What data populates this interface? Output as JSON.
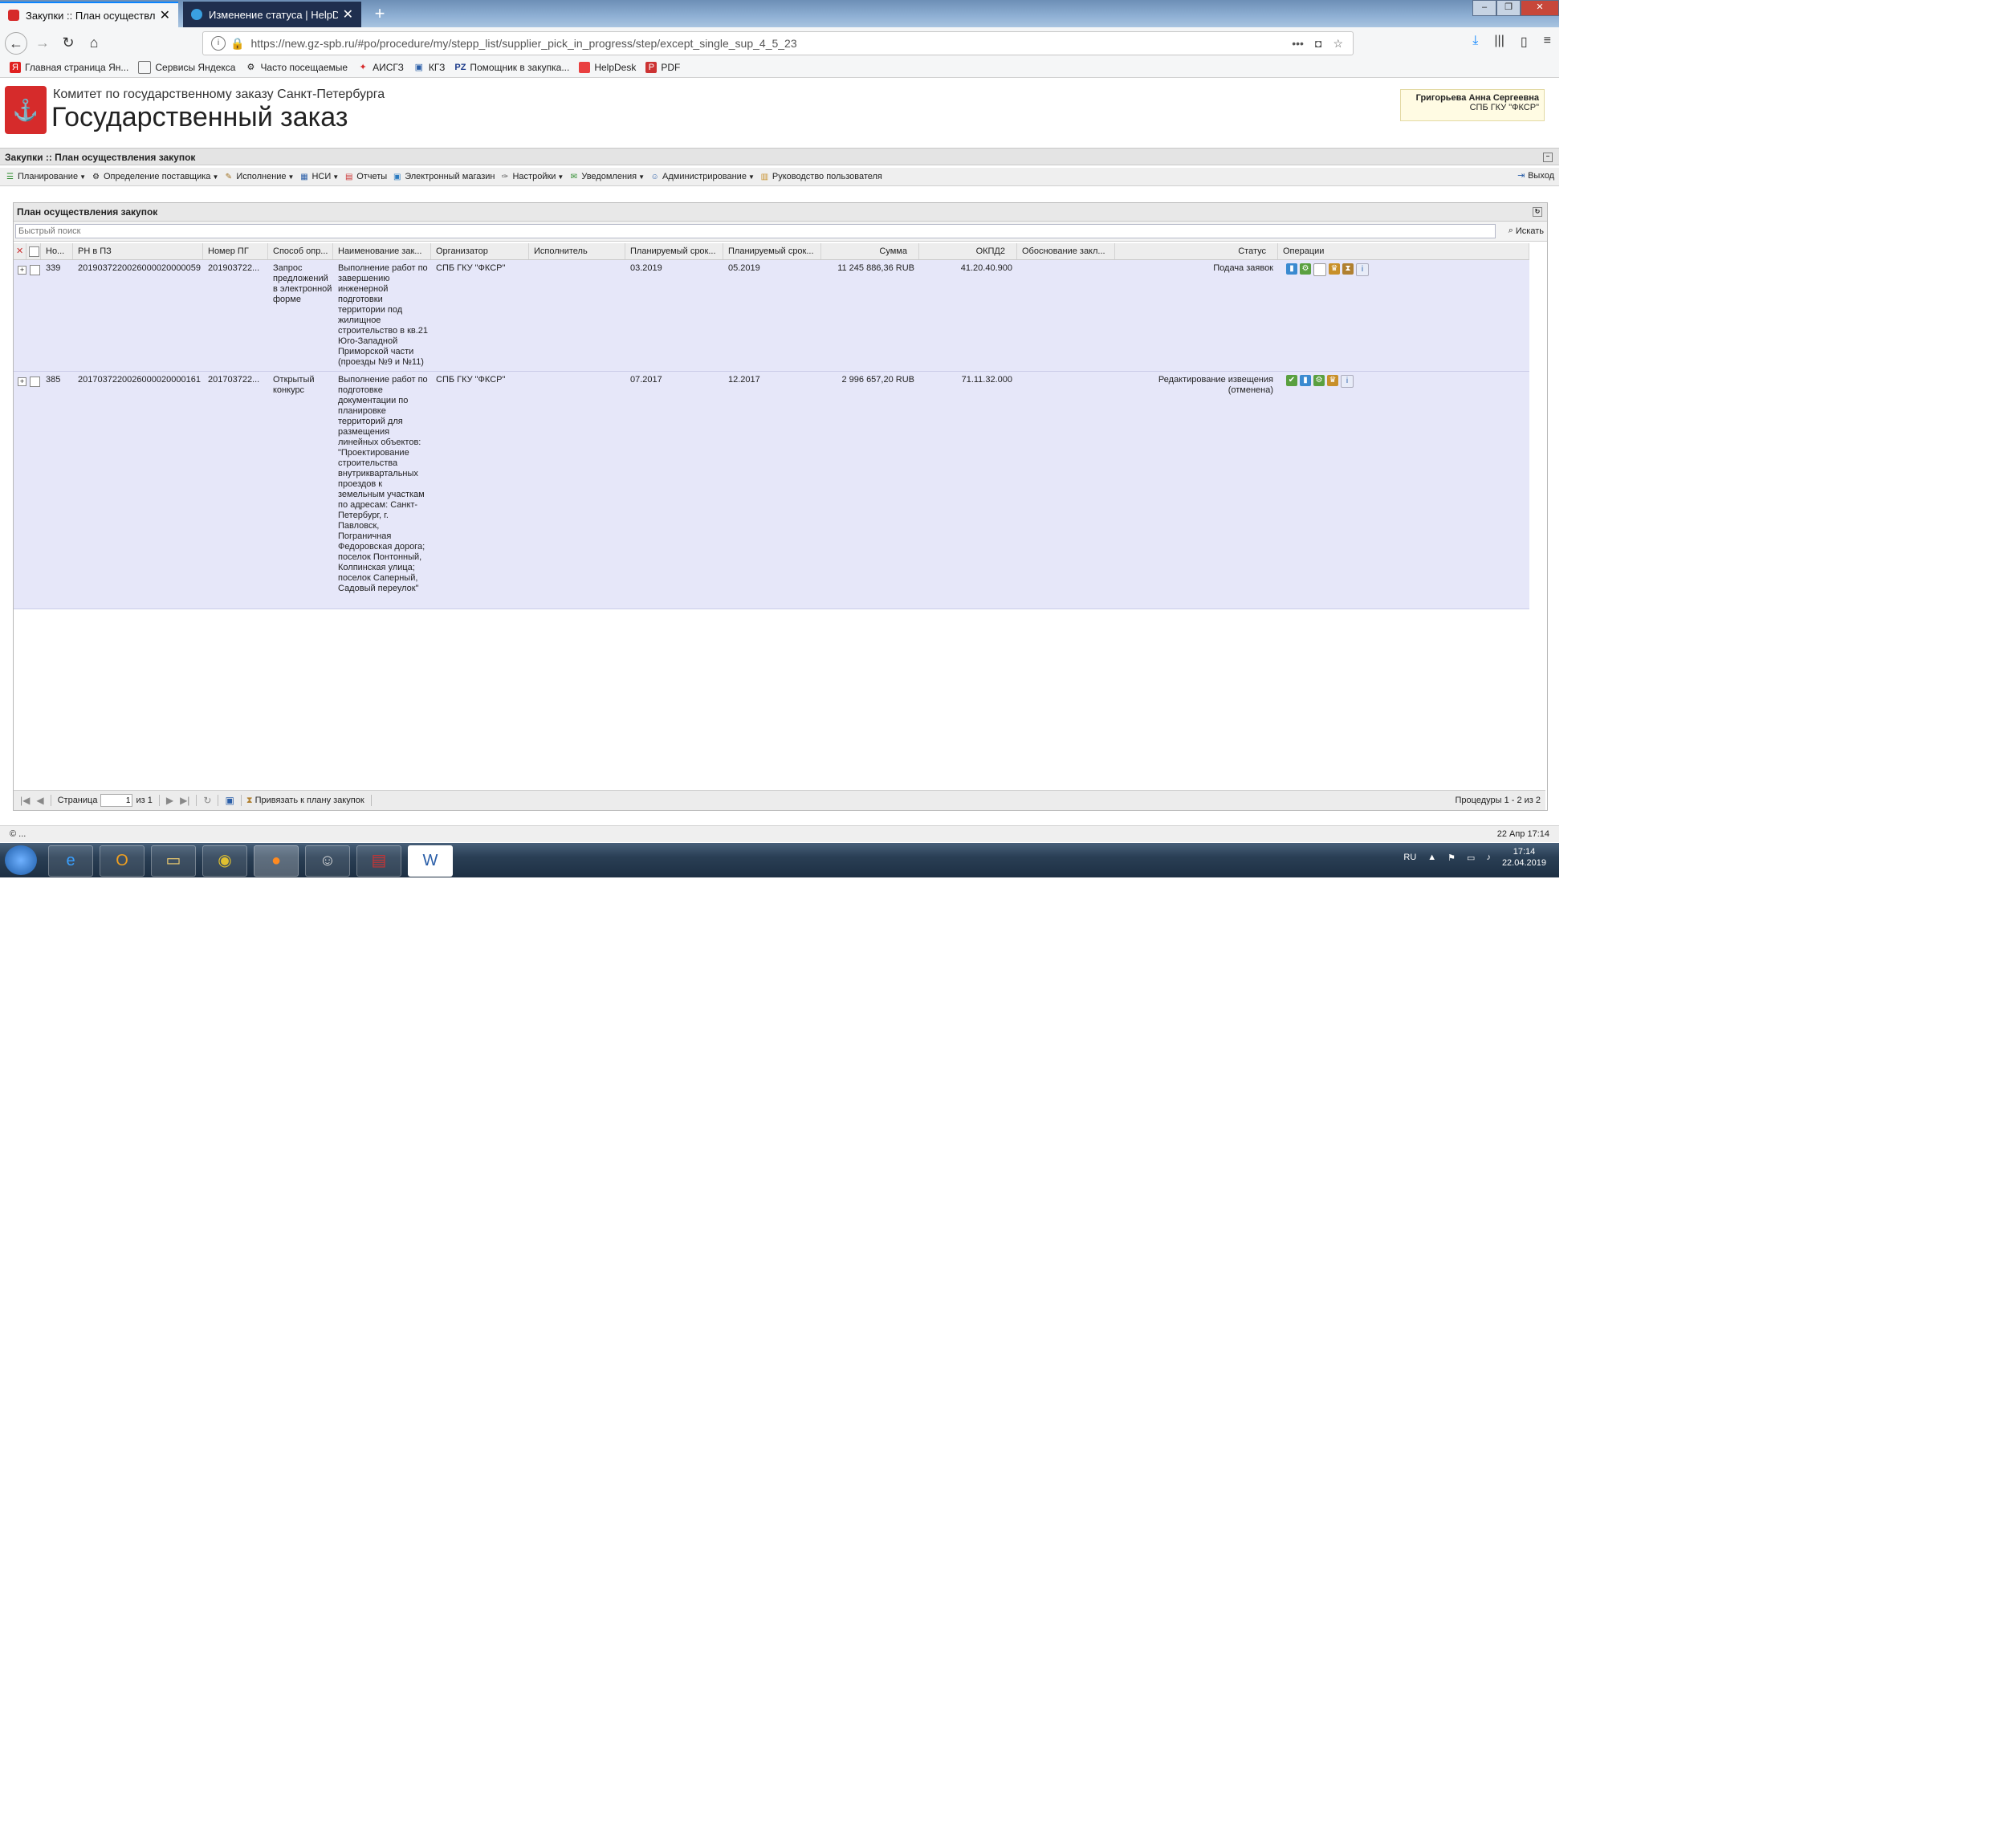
{
  "browser": {
    "tabs": [
      {
        "title": "Закупки :: План осуществлен",
        "active": true
      },
      {
        "title": "Изменение статуса | HelpDesk",
        "active": false
      }
    ],
    "url": "https://new.gz-spb.ru/#po/procedure/my/stepp_list/supplier_pick_in_progress/step/except_single_sup_4_5_23",
    "bookmarks": [
      "Главная страница Ян...",
      "Сервисы Яндекса",
      "Часто посещаемые",
      "АИСГЗ",
      "КГЗ",
      "Помощник в закупка...",
      "HelpDesk",
      "PDF"
    ]
  },
  "header": {
    "committee": "Комитет по государственному заказу Санкт-Петербурга",
    "title": "Государственный заказ",
    "user_name": "Григорьева Анна Сергеевна",
    "user_org": "СПБ ГКУ \"ФКСР\""
  },
  "section_title": "Закупки :: План осуществления закупок",
  "menu": {
    "items": [
      "Планирование",
      "Определение поставщика",
      "Исполнение",
      "НСИ",
      "Отчеты",
      "Электронный магазин",
      "Настройки",
      "Уведомления",
      "Администрирование",
      "Руководство пользователя"
    ],
    "exit": "Выход"
  },
  "panel": {
    "title": "План осуществления закупок",
    "search_placeholder": "Быстрый поиск",
    "search_button": "Искать"
  },
  "grid": {
    "columns": [
      "Но...",
      "РН в ПЗ",
      "Номер ПГ",
      "Способ опр...",
      "Наименование зак...",
      "Организатор",
      "Исполнитель",
      "Планируемый срок...",
      "Планируемый срок...",
      "Сумма",
      "ОКПД2",
      "Обоснование закл...",
      "Статус",
      "Операции"
    ],
    "rows": [
      {
        "no": "339",
        "rn": "2019037220026000020000059",
        "pg": "201903722...",
        "method": "Запрос предложений в электронной форме",
        "name": "Выполнение работ по завершению инженерной подготовки территории под жилищное строительство в кв.21 Юго-Западной Приморской части (проезды №9 и №11)",
        "organizer": "СПБ ГКУ \"ФКСР\"",
        "executor": "",
        "plan1": "03.2019",
        "plan2": "05.2019",
        "sum": "11 245 886,36 RUB",
        "okpd": "41.20.40.900",
        "reason": "",
        "status": "Подача заявок"
      },
      {
        "no": "385",
        "rn": "2017037220026000020000161",
        "pg": "201703722...",
        "method": "Открытый конкурс",
        "name": "Выполнение работ по подготовке документации по планировке территорий для размещения линейных объектов: \"Проектирование строительства внутриквартальных проездов к земельным участкам по адресам: Санкт-Петербург, г. Павловск, Пограничная Федоровская дорога; поселок Понтонный, Колпинская улица; поселок Саперный, Садовый переулок\"",
        "organizer": "СПБ ГКУ \"ФКСР\"",
        "executor": "",
        "plan1": "07.2017",
        "plan2": "12.2017",
        "sum": "2 996 657,20 RUB",
        "okpd": "71.11.32.000",
        "reason": "",
        "status": "Редактирование извещения (отменена)"
      }
    ]
  },
  "pager": {
    "page_label": "Страница",
    "page_value": "1",
    "of_label": "из 1",
    "bind_button": "Привязать к плану закупок",
    "info": "Процедуры 1 - 2 из 2"
  },
  "statusbar": {
    "left": "© ...",
    "right": "22 Апр 17:14"
  },
  "taskbar": {
    "lang": "RU",
    "time": "17:14",
    "date": "22.04.2019"
  }
}
